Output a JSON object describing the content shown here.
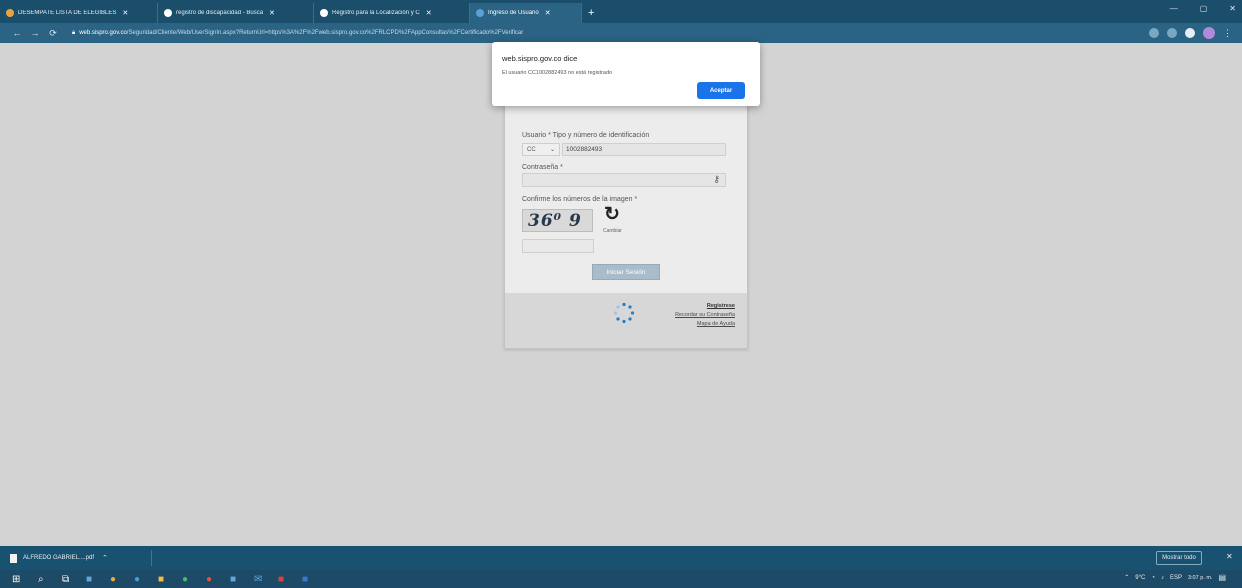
{
  "browser": {
    "tabs": [
      {
        "title": "DESEMPATE LISTA DE ELEGIBLES",
        "favicon_color": "#e8a33d",
        "active": false
      },
      {
        "title": "registro de discapacidad - Busca",
        "favicon_color": "#ffffff",
        "active": false
      },
      {
        "title": "Registro para la Localización y C",
        "favicon_color": "#ffffff",
        "active": false
      },
      {
        "title": "Ingreso de Usuario",
        "favicon_color": "#5aa0d6",
        "active": true
      }
    ],
    "new_tab": "+",
    "window_controls": [
      "—",
      "▢",
      "✕"
    ],
    "url_host": "web.sispro.gov.co",
    "url_path": "/Seguridad/Cliente/Web/UserSignIn.aspx?ReturnUrl=https%3A%2F%2Fweb.sispro.gov.co%2FRLCPD%2FAppConsultas%2FCertificado%2FVerificar"
  },
  "alert": {
    "origin": "web.sispro.gov.co dice",
    "message": "El usuario CC1002882493 no está registrado",
    "ok_label": "Aceptar"
  },
  "login": {
    "user_label": "Usuario * Tipo y número de identificación",
    "doc_type": "CC",
    "doc_number": "1002882493",
    "password_label": "Contraseña *",
    "captcha_label": "Confirme los números de la imagen *",
    "captcha_text": "36⁰ 9",
    "refresh_label": "Cambiar",
    "login_button": "Iniciar Sesión",
    "links": [
      "Registrese",
      "Recordar su Contraseña",
      "Mapa de Ayuda"
    ]
  },
  "downloads": {
    "file_name": "ALFREDO GABRIEL....pdf",
    "show_all": "Mostrar todo",
    "close": "✕"
  },
  "taskbar": {
    "time": "3:07 p. m.",
    "date": "",
    "lang": "ESP",
    "temp": "9°C"
  }
}
